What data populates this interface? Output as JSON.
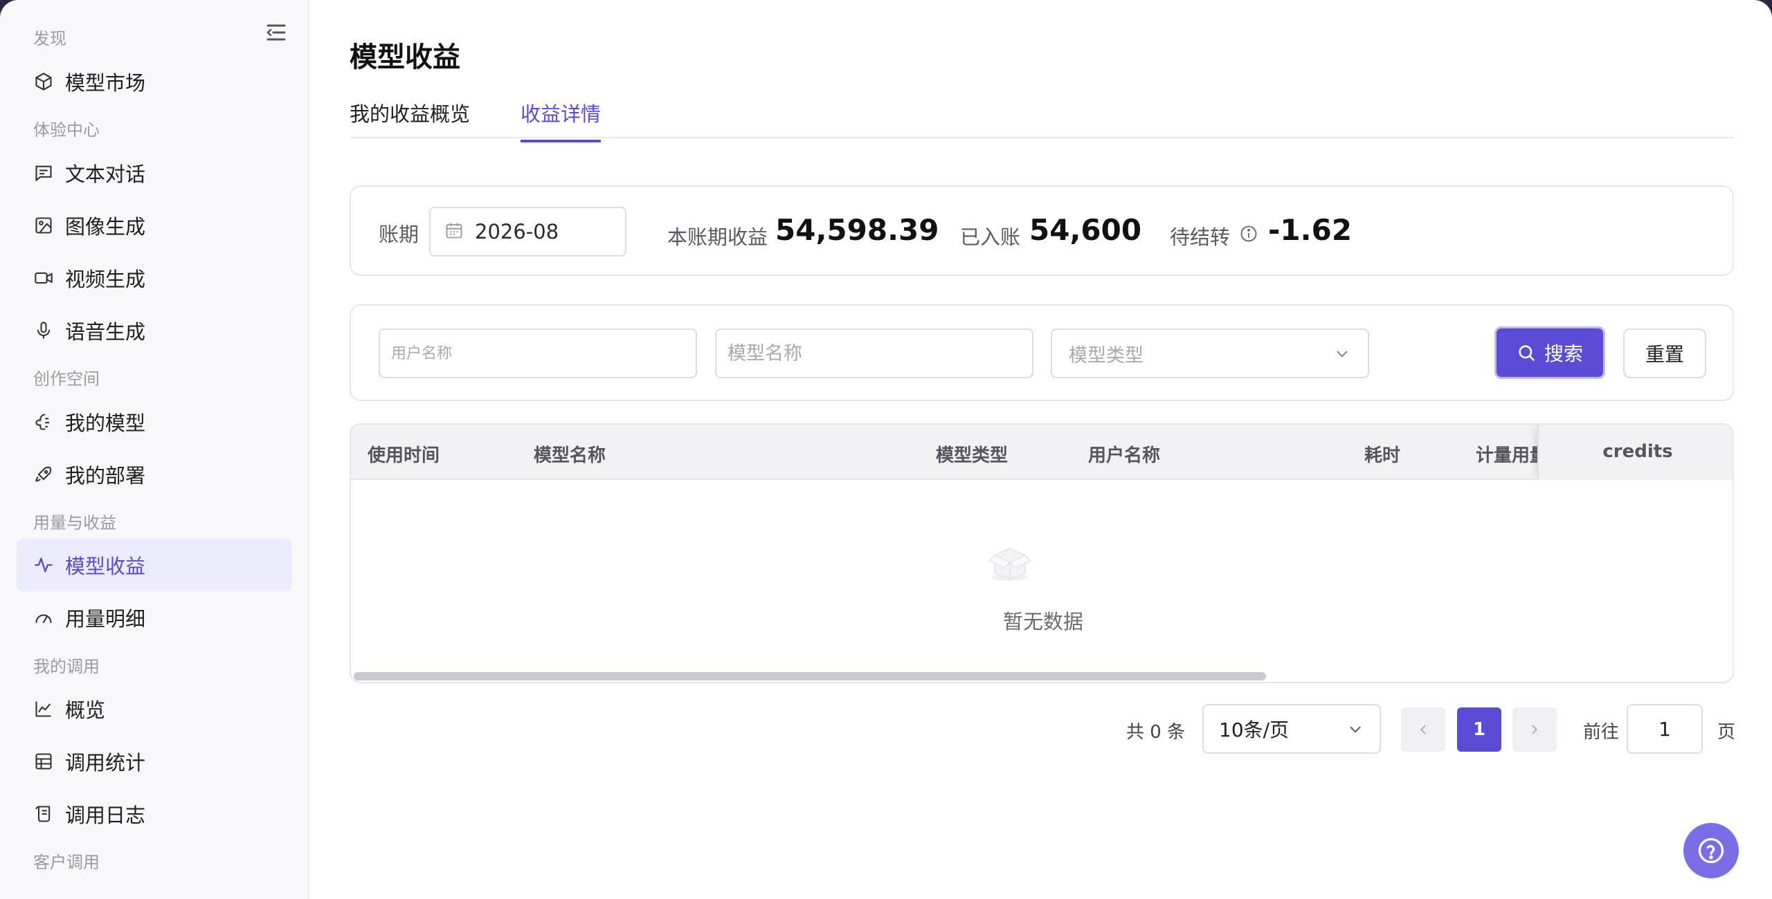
{
  "sidebar": {
    "sections": {
      "discover": "发现",
      "experience": "体验中心",
      "creation": "创作空间",
      "usage": "用量与收益",
      "my_calls": "我的调用",
      "customer_calls": "客户调用"
    },
    "items": [
      {
        "label": "模型市场",
        "icon": "cube-icon"
      },
      {
        "label": "文本对话",
        "icon": "chat-icon"
      },
      {
        "label": "图像生成",
        "icon": "image-icon"
      },
      {
        "label": "视频生成",
        "icon": "video-icon"
      },
      {
        "label": "语音生成",
        "icon": "microphone-icon"
      },
      {
        "label": "我的模型",
        "icon": "brain-icon"
      },
      {
        "label": "我的部署",
        "icon": "rocket-icon"
      },
      {
        "label": "模型收益",
        "icon": "pulse-icon",
        "active": true
      },
      {
        "label": "用量明细",
        "icon": "gauge-icon"
      },
      {
        "label": "概览",
        "icon": "line-chart-icon"
      },
      {
        "label": "调用统计",
        "icon": "table-icon"
      },
      {
        "label": "调用日志",
        "icon": "scroll-icon"
      }
    ]
  },
  "page": {
    "title": "模型收益",
    "tabs": [
      {
        "label": "我的收益概览",
        "active": false
      },
      {
        "label": "收益详情",
        "active": true
      }
    ]
  },
  "summary": {
    "period_label": "账期",
    "period_value": "2026-08",
    "current_income_label": "本账期收益",
    "current_income_value": "54,598.39",
    "settled_label": "已入账",
    "settled_value": "54,600",
    "pending_label": "待结转",
    "pending_value": "-1.62"
  },
  "filters": {
    "user_placeholder": "用户名称",
    "model_placeholder": "模型名称",
    "type_placeholder": "模型类型",
    "search_label": "搜索",
    "reset_label": "重置"
  },
  "table": {
    "columns": [
      "使用时间",
      "模型名称",
      "模型类型",
      "用户名称",
      "耗时",
      "计量用量",
      "credits"
    ],
    "empty_text": "暂无数据"
  },
  "pagination": {
    "total_text": "共 0 条",
    "page_size": "10条/页",
    "current_page": "1",
    "goto_label": "前往",
    "goto_value": "1",
    "page_suffix": "页"
  },
  "colors": {
    "accent": "#5b4bd4",
    "active_bg": "#ecebfb"
  }
}
